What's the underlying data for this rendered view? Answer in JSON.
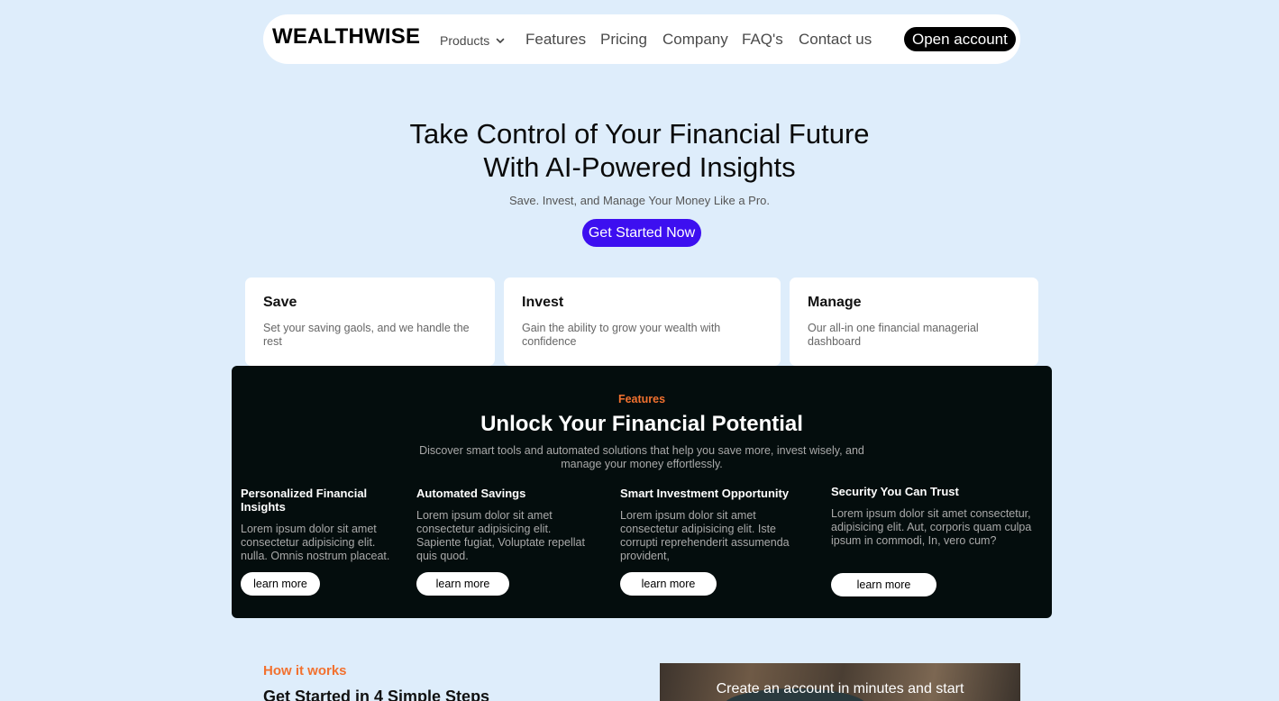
{
  "nav": {
    "logo": "WEALTHWISE",
    "products": "Products",
    "links": [
      "Features",
      "Pricing",
      "Company",
      "FAQ's",
      "Contact us"
    ],
    "cta": "Open account"
  },
  "hero": {
    "title_line1": "Take Control of Your Financial Future",
    "title_line2": "With AI-Powered Insights",
    "subtitle": "Save. Invest, and Manage Your Money Like a Pro.",
    "cta": "Get Started Now",
    "cta_color": "#3d0ff0"
  },
  "cards": [
    {
      "title": "Save",
      "text": "Set your saving gaols, and we handle the rest"
    },
    {
      "title": "Invest",
      "text": "Gain the ability to grow your wealth with confidence"
    },
    {
      "title": "Manage",
      "text": "Our all-in one financial managerial dashboard"
    }
  ],
  "features": {
    "tag": "Features",
    "title": "Unlock Your Financial Potential",
    "description": "Discover smart tools and automated solutions that help you save more, invest wisely, and manage your money effortlessly.",
    "accent_color": "#f2712f",
    "items": [
      {
        "title": "Personalized Financial Insights",
        "text": "Lorem ipsum dolor sit amet consectetur adipisicing elit. nulla. Omnis nostrum placeat.",
        "button": "learn more"
      },
      {
        "title": "Automated Savings",
        "text": "Lorem ipsum dolor sit amet consectetur adipisicing elit. Sapiente fugiat, Voluptate repellat quis quod.",
        "button": "learn more"
      },
      {
        "title": "Smart Investment Opportunity",
        "text": "Lorem ipsum dolor sit amet consectetur adipisicing elit. Iste corrupti reprehenderit assumenda provident,",
        "button": "learn more"
      },
      {
        "title": "Security You Can Trust",
        "text": "Lorem ipsum dolor sit amet consectetur, adipisicing elit. Aut, corporis quam culpa ipsum in commodi, In, vero cum?",
        "button": "learn more"
      }
    ]
  },
  "how": {
    "tag": "How it works",
    "title": "Get Started in 4 Simple Steps",
    "image_text": "Create an account in minutes and start"
  }
}
